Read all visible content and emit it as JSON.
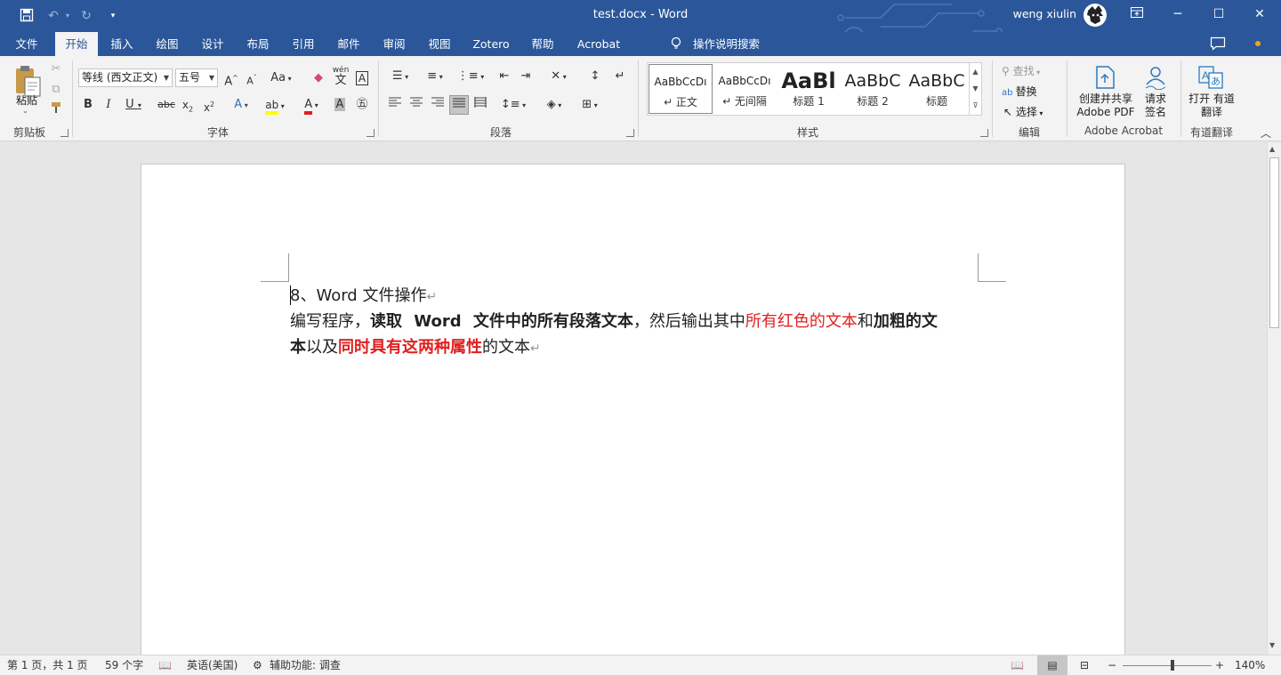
{
  "titlebar": {
    "title": "test.docx  -  Word",
    "user_name": "weng xiulin",
    "qat": {
      "save_icon": "save-icon",
      "undo_icon": "undo-icon",
      "redo_icon": "redo-icon",
      "customize_icon": "chevron-down-icon"
    }
  },
  "tabs": [
    "文件",
    "开始",
    "插入",
    "绘图",
    "设计",
    "布局",
    "引用",
    "邮件",
    "审阅",
    "视图",
    "Zotero",
    "帮助",
    "Acrobat"
  ],
  "tell_me": "操作说明搜索",
  "ribbon": {
    "clipboard": {
      "paste_label": "粘贴",
      "group_label": "剪贴板"
    },
    "font": {
      "font_name": "等线 (西文正文)",
      "font_size": "五号",
      "group_label": "字体",
      "case_label": "Aa",
      "phonetic_label": "wén"
    },
    "paragraph": {
      "group_label": "段落"
    },
    "styles": {
      "group_label": "样式",
      "items": [
        {
          "sample": "AaBbCcDı",
          "name": "↵ 正文"
        },
        {
          "sample": "AaBbCcDı",
          "name": "↵ 无间隔"
        },
        {
          "sample": "AaBl",
          "name": "标题 1"
        },
        {
          "sample": "AaBbC",
          "name": "标题 2"
        },
        {
          "sample": "AaBbC",
          "name": "标题"
        }
      ]
    },
    "editing": {
      "find": "查找",
      "replace": "替换",
      "select": "选择",
      "group_label": "编辑"
    },
    "acrobat": {
      "create_label": "创建并共享 Adobe PDF",
      "sign_label": "请求 签名",
      "group_label": "Adobe Acrobat"
    },
    "youdao": {
      "open_label": "打开 有道翻译",
      "group_label": "有道翻译"
    }
  },
  "document": {
    "line1": "8、Word 文件操作",
    "line2_a": "编写程序，",
    "line2_b": "读取 Word 文件中的所有段落文本",
    "line2_c": "，然后输出其中",
    "line2_d": "所有红色的文本",
    "line2_e": "和",
    "line2_f": "加粗的文",
    "line3_a": "本",
    "line3_b": "以及",
    "line3_c": "同时具有这两种属性",
    "line3_d": "的文本",
    "para_mark": "↵"
  },
  "statusbar": {
    "page": "第 1 页，共 1 页",
    "words": "59 个字",
    "language": "英语(美国)",
    "accessibility": "辅助功能: 调查",
    "zoom": "140%",
    "zoom_level": 0.56
  },
  "colors": {
    "brand": "#2b579a",
    "red_text": "#e02020"
  }
}
